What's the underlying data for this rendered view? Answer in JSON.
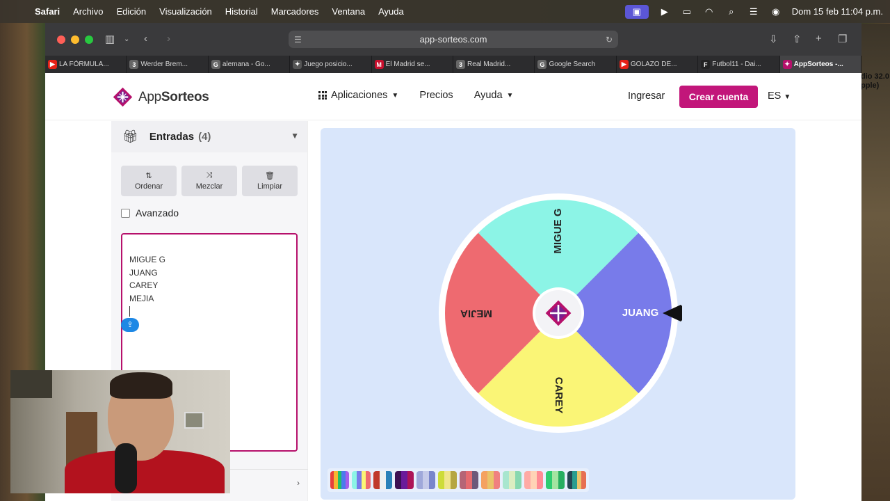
{
  "menubar": {
    "app": "Safari",
    "items": [
      "Archivo",
      "Edición",
      "Visualización",
      "Historial",
      "Marcadores",
      "Ventana",
      "Ayuda"
    ],
    "clock": "Dom 15 feb 11:04 p.m."
  },
  "desktop": {
    "side_text_1": "dio 32.0",
    "side_text_2": "pple)"
  },
  "browser": {
    "url": "app-sorteos.com",
    "tabs": [
      {
        "label": "LA FÓRMULA...",
        "fav": "▶",
        "fav_color": "#e62117"
      },
      {
        "label": "Werder Brem...",
        "fav": "3",
        "fav_color": "#666666"
      },
      {
        "label": "alemana - Go...",
        "fav": "G",
        "fav_color": "#666666"
      },
      {
        "label": "Juego posicio...",
        "fav": "✦",
        "fav_color": "#555555"
      },
      {
        "label": "El Madrid se...",
        "fav": "M",
        "fav_color": "#c8102e"
      },
      {
        "label": "Real Madrid...",
        "fav": "3",
        "fav_color": "#666666"
      },
      {
        "label": "Google Search",
        "fav": "G",
        "fav_color": "#666666"
      },
      {
        "label": "GOLAZO DE...",
        "fav": "▶",
        "fav_color": "#e62117"
      },
      {
        "label": "Futbol11 - Dai...",
        "fav": "F",
        "fav_color": "#222222"
      },
      {
        "label": "AppSorteos -...",
        "fav": "✦",
        "fav_color": "#b6106b"
      }
    ]
  },
  "site": {
    "logo_part1": "App",
    "logo_part2": "Sorteos",
    "nav": {
      "apps": "Aplicaciones",
      "prices": "Precios",
      "help": "Ayuda"
    },
    "login": "Ingresar",
    "signup": "Crear cuenta",
    "lang": "ES",
    "brand_color": "#c2167a"
  },
  "entries": {
    "title": "Entradas",
    "count": "(4)",
    "sort": "Ordenar",
    "shuffle": "Mezclar",
    "clear": "Limpiar",
    "advanced": "Avanzado",
    "names": [
      "MIGUE G",
      "JUANG",
      "CAREY",
      "MEJIA"
    ]
  },
  "wheel": {
    "segments": [
      {
        "label": "MIGUE G",
        "color": "#8cf4e6"
      },
      {
        "label": "JUANG",
        "color": "#787bea"
      },
      {
        "label": "CAREY",
        "color": "#faf576"
      },
      {
        "label": "MEJIA",
        "color": "#ee6a70"
      }
    ]
  },
  "palettes": [
    [
      "#e8413c",
      "#f7b731",
      "#20bf6b",
      "#4b7bec",
      "#a55eea"
    ],
    [
      "#8cf4e6",
      "#787bea",
      "#faf576",
      "#ee6a70"
    ],
    [
      "#c0392b",
      "#ecf0f1",
      "#2980b9"
    ],
    [
      "#3c1053",
      "#6a1b9a",
      "#ad1457"
    ],
    [
      "#9fa8da",
      "#c5cae9",
      "#7986cb"
    ],
    [
      "#cddc39",
      "#f0e68c",
      "#b5a642"
    ],
    [
      "#b56576",
      "#e56b6f",
      "#6d597a"
    ],
    [
      "#f4a261",
      "#e9c46a",
      "#f08080"
    ],
    [
      "#a8e6cf",
      "#dcedc1",
      "#88d8b0"
    ],
    [
      "#ffaaa5",
      "#ffd3b6",
      "#ff8b94"
    ],
    [
      "#2ecc71",
      "#a3e4a1",
      "#27ae60"
    ],
    [
      "#264653",
      "#2a9d8f",
      "#e9c46a",
      "#e76f51"
    ]
  ]
}
